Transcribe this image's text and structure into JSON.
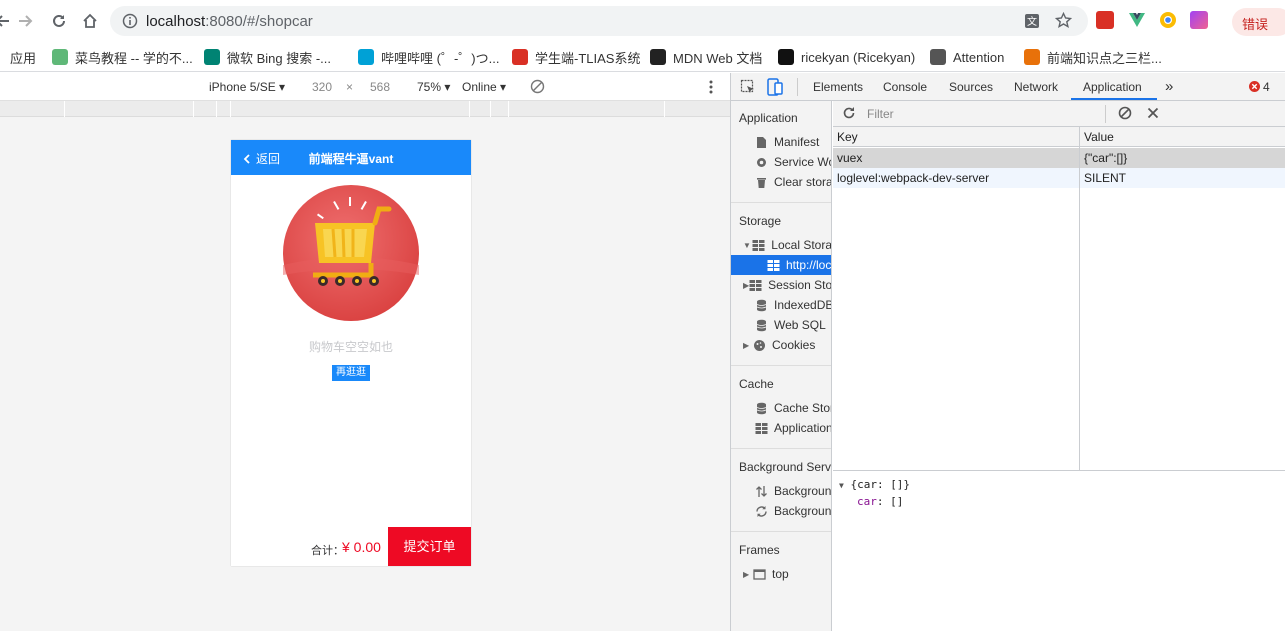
{
  "browser": {
    "url_host": "localhost",
    "url_rest": ":8080/#/shopcar",
    "error_badge": "错误"
  },
  "bookmarks": [
    {
      "label": "应用",
      "icon": "apps-icon",
      "color": "#4285f4"
    },
    {
      "label": "菜鸟教程 -- 学的不...",
      "icon": "runoob-icon",
      "color": "#5fb878"
    },
    {
      "label": "微软 Bing 搜索 -...",
      "icon": "bing-icon",
      "color": "#008373"
    },
    {
      "label": "哔哩哔哩 (゜-゜)つ...",
      "icon": "bilibili-icon",
      "color": "#00a1d6"
    },
    {
      "label": "学生端-TLIAS系统",
      "icon": "tlias-icon",
      "color": "#d93025"
    },
    {
      "label": "MDN Web 文档",
      "icon": "mdn-icon",
      "color": "#222222"
    },
    {
      "label": "ricekyan (Ricekyan)",
      "icon": "github-icon",
      "color": "#111111"
    },
    {
      "label": "Attention",
      "icon": "globe-icon",
      "color": "#555555"
    },
    {
      "label": "前端知识点之三栏...",
      "icon": "note-icon",
      "color": "#e8710a"
    }
  ],
  "device_bar": {
    "device": "iPhone 5/SE",
    "width": "320",
    "times": "×",
    "height": "568",
    "zoom": "75%",
    "network": "Online"
  },
  "phone": {
    "nav_back": "返回",
    "nav_title": "前端程牛逼vant",
    "empty_text": "购物车空空如也",
    "go_button": "再逛逛",
    "total_label": "合计：",
    "total_value": "¥ 0.00",
    "submit_button": "提交订单"
  },
  "devtools": {
    "tabs": [
      "Elements",
      "Console",
      "Sources",
      "Network",
      "Application"
    ],
    "more_tabs": "»",
    "error_count": "4",
    "active_tab": "Application",
    "sidebar": {
      "application_head": "Application",
      "application_items": [
        "Manifest",
        "Service Wo",
        "Clear stora"
      ],
      "storage_head": "Storage",
      "storage_items": [
        "Local Stora",
        "http://loc",
        "Session Sto",
        "IndexedDB",
        "Web SQL",
        "Cookies"
      ],
      "cache_head": "Cache",
      "cache_items": [
        "Cache Stor",
        "Application"
      ],
      "bg_head": "Background Servi",
      "bg_items": [
        "Background",
        "Background"
      ],
      "frames_head": "Frames",
      "frames_items": [
        "top"
      ]
    },
    "filter_placeholder": "Filter",
    "table": {
      "col_key": "Key",
      "col_value": "Value",
      "rows": [
        {
          "key": "vuex",
          "value": "{\"car\":[]}"
        },
        {
          "key": "loglevel:webpack-dev-server",
          "value": "SILENT"
        }
      ]
    },
    "preview": {
      "line1": "{car: []}",
      "line2_key": "car",
      "line2_val": ": []"
    }
  },
  "colors": {
    "vant_blue": "#1989fa",
    "vant_red": "#ee0a24",
    "devtools_select": "#1a73e8"
  }
}
